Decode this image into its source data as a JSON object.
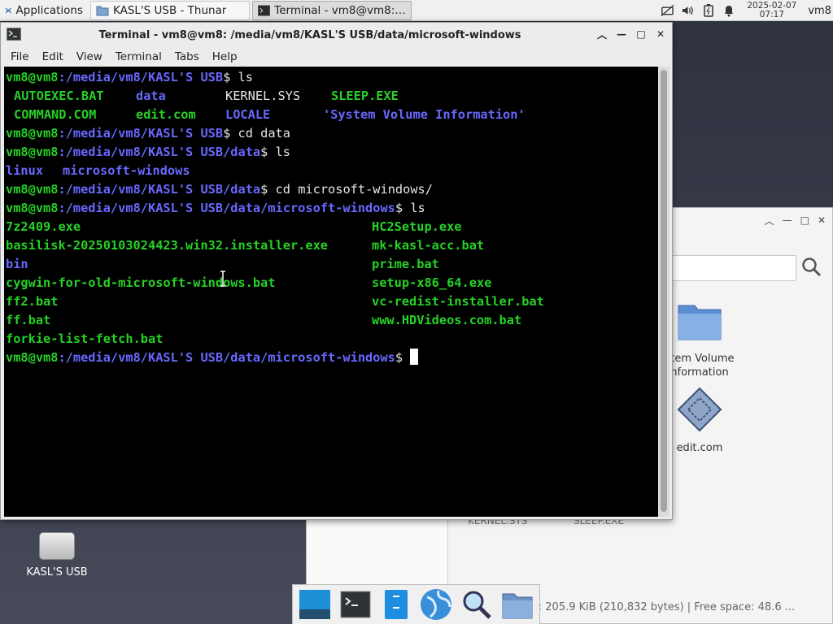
{
  "panel": {
    "apps_label": "Applications",
    "tasks": [
      {
        "label": "KASL'S USB - Thunar"
      },
      {
        "label": "Terminal - vm8@vm8: /..."
      }
    ],
    "date": "2025-02-07",
    "time": "07:17",
    "user": "vm8",
    "icons": [
      "network-icon",
      "volume-icon",
      "battery-icon",
      "notification-bell-icon"
    ]
  },
  "terminal": {
    "title": "Terminal - vm8@vm8: /media/vm8/KASL'S USB/data/microsoft-windows",
    "menu": [
      "File",
      "Edit",
      "View",
      "Terminal",
      "Tabs",
      "Help"
    ],
    "prompt_user": "vm8@vm8",
    "lines": {
      "p1_path": ":/media/vm8/KASL'S USB",
      "p1_cmd": "$ ls",
      "ls1": {
        "c1a": "AUTOEXEC.BAT",
        "c2a": "data",
        "c3a": "KERNEL.SYS",
        "c4a": "SLEEP.EXE",
        "c1b": "COMMAND.COM",
        "c2b": "edit.com",
        "c3b": "LOCALE",
        "c4b": "'System Volume Information'"
      },
      "p2_path": ":/media/vm8/KASL'S USB",
      "p2_cmd": "$ cd data",
      "p3_path": ":/media/vm8/KASL'S USB/data",
      "p3_cmd": "$ ls",
      "ls2_a": "linux",
      "ls2_b": "microsoft-windows",
      "p4_path": ":/media/vm8/KASL'S USB/data",
      "p4_cmd": "$ cd microsoft-windows/",
      "p5_path": ":/media/vm8/KASL'S USB/data/microsoft-windows",
      "p5_cmd": "$ ls",
      "files": [
        [
          "7z2409.exe",
          "HC2Setup.exe"
        ],
        [
          "basilisk-20250103024423.win32.installer.exe",
          "mk-kasl-acc.bat"
        ],
        [
          "bin",
          "prime.bat"
        ],
        [
          "cygwin-for-old-microsoft-windows.bat",
          "setup-x86_64.exe"
        ],
        [
          "ff2.bat",
          "vc-redist-installer.bat"
        ],
        [
          "ff.bat",
          "www.HDVideos.com.bat"
        ],
        [
          "forkie-list-fetch.bat",
          ""
        ]
      ],
      "p6_path": ":/media/vm8/KASL'S USB/data/microsoft-windows",
      "p6_cmd": "$ "
    }
  },
  "thunar": {
    "icons": [
      {
        "label": "stem Volume\nnformation"
      },
      {
        "label": "edit.com"
      }
    ],
    "hidden_labels": [
      "KERNEL.SYS",
      "SLEEP.EXE"
    ],
    "status": "es: 205.9 KiB (210,832 bytes)  |  Free space: 48.6 ..."
  },
  "desktop": {
    "usb_label": "KASL'S USB"
  },
  "colors": {
    "prompt_green": "#26d126",
    "dir_blue": "#6868ff",
    "terminal_bg": "#000000"
  }
}
